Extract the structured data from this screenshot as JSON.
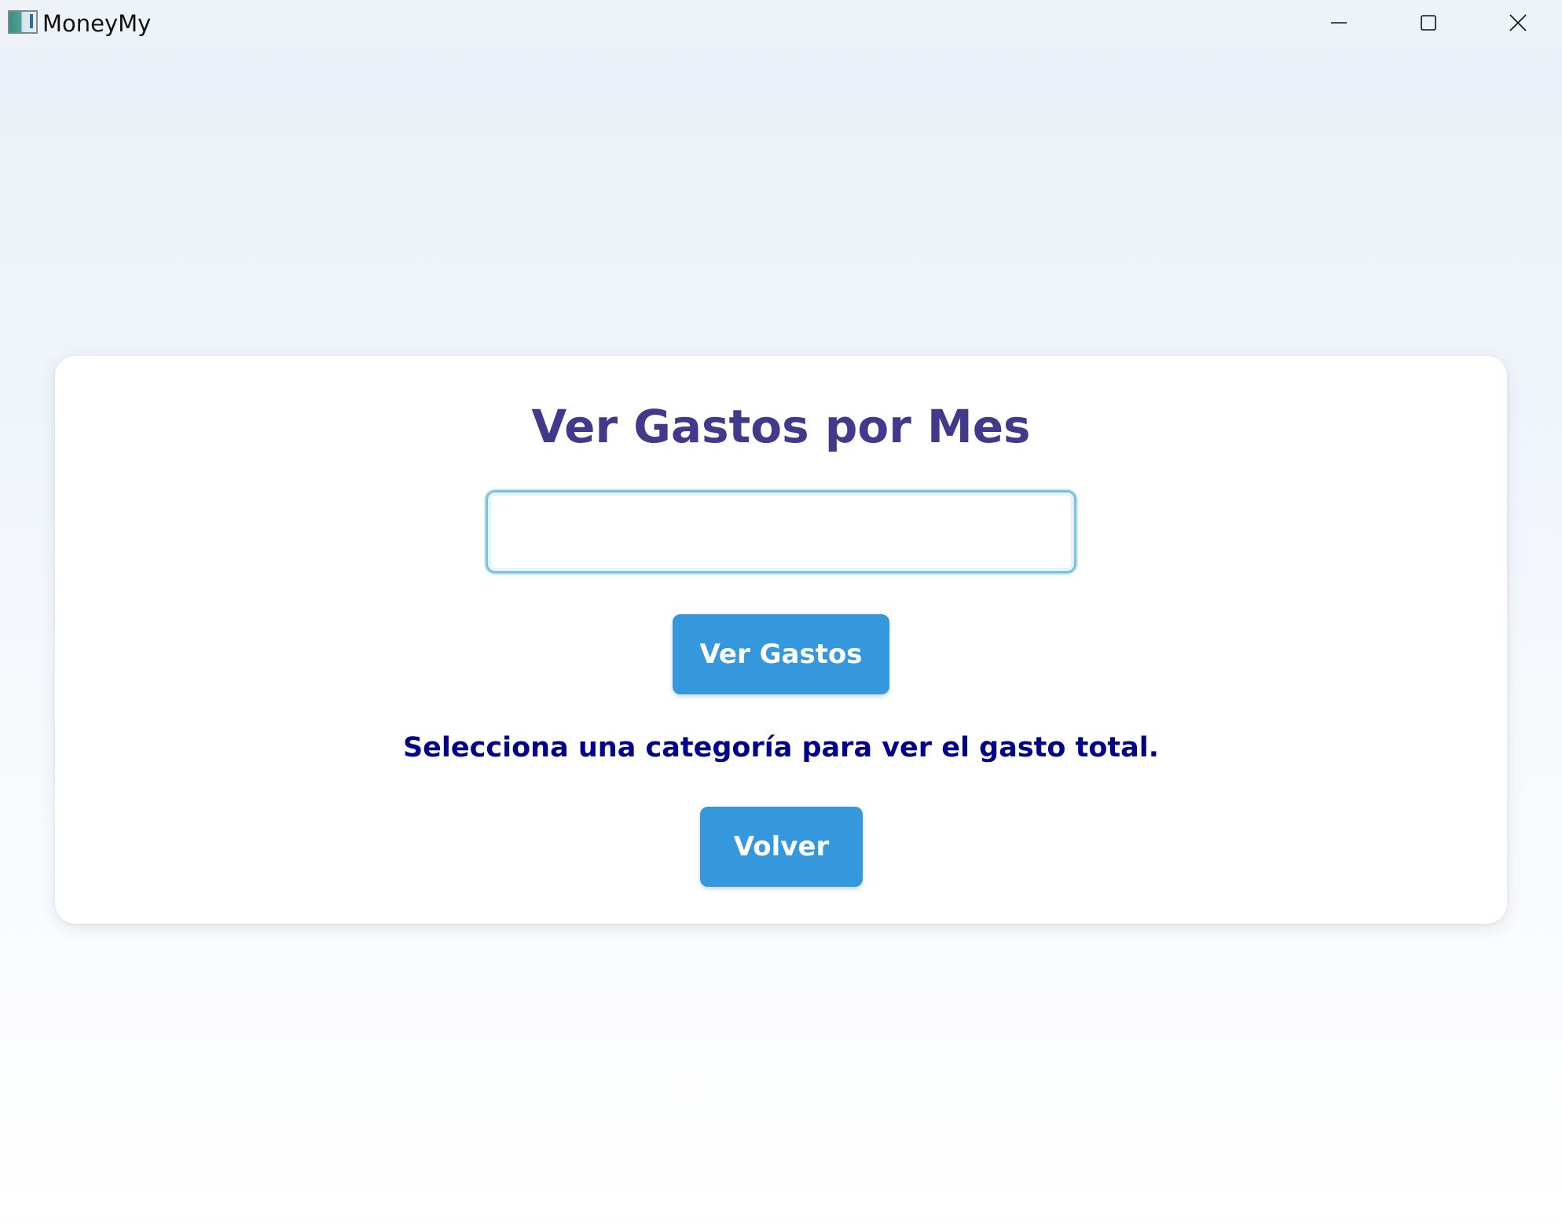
{
  "window": {
    "title": "MoneyMy",
    "icon": "app-chart-icon",
    "controls": {
      "minimize_icon": "minimize-icon",
      "maximize_icon": "maximize-icon",
      "close_icon": "close-icon"
    }
  },
  "main": {
    "title": "Ver Gastos por Mes",
    "month_input": {
      "value": "",
      "placeholder": ""
    },
    "view_button_label": "Ver Gastos",
    "status_text": "Selecciona una categoría para ver el gasto total.",
    "back_button_label": "Volver"
  },
  "colors": {
    "title": "#41398a",
    "button": "#3698dc",
    "status_text": "#00008b",
    "input_border": "#7fc1d8"
  }
}
